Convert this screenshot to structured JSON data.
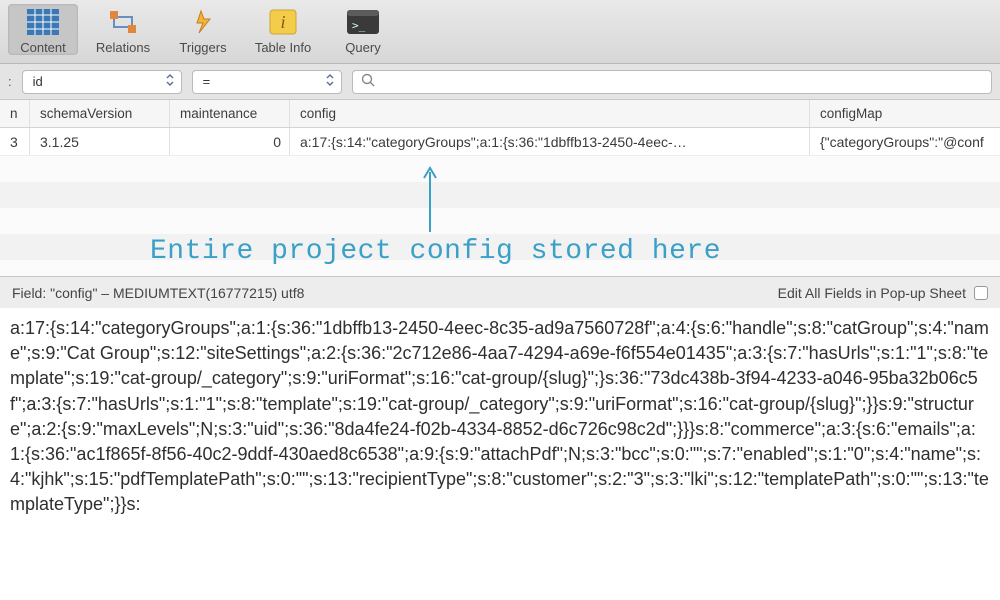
{
  "toolbar": {
    "items": [
      {
        "label": "Content",
        "icon": "table-icon",
        "selected": true
      },
      {
        "label": "Relations",
        "icon": "relations-icon",
        "selected": false
      },
      {
        "label": "Triggers",
        "icon": "triggers-icon",
        "selected": false
      },
      {
        "label": "Table Info",
        "icon": "info-icon",
        "selected": false
      },
      {
        "label": "Query",
        "icon": "terminal-icon",
        "selected": false
      }
    ]
  },
  "filter": {
    "prefix": ":",
    "field": "id",
    "operator": "=",
    "search_placeholder": ""
  },
  "columns": {
    "n": "n",
    "schemaVersion": "schemaVersion",
    "maintenance": "maintenance",
    "config": "config",
    "configMap": "configMap"
  },
  "row": {
    "n": "3",
    "schemaVersion": "3.1.25",
    "maintenance": "0",
    "config": "a:17:{s:14:\"categoryGroups\";a:1:{s:36:\"1dbffb13-2450-4eec-…",
    "configMap": "{\"categoryGroups\":\"@conf"
  },
  "annotation": {
    "text": "Entire project config stored here"
  },
  "detail": {
    "field_label": "Field: \"config\" – MEDIUMTEXT(16777215) utf8",
    "edit_label": "Edit All Fields in Pop-up Sheet"
  },
  "config_full": "a:17:{s:14:\"categoryGroups\";a:1:{s:36:\"1dbffb13-2450-4eec-8c35-ad9a7560728f\";a:4:{s:6:\"handle\";s:8:\"catGroup\";s:4:\"name\";s:9:\"Cat Group\";s:12:\"siteSettings\";a:2:{s:36:\"2c712e86-4aa7-4294-a69e-f6f554e01435\";a:3:{s:7:\"hasUrls\";s:1:\"1\";s:8:\"template\";s:19:\"cat-group/_category\";s:9:\"uriFormat\";s:16:\"cat-group/{slug}\";}s:36:\"73dc438b-3f94-4233-a046-95ba32b06c5f\";a:3:{s:7:\"hasUrls\";s:1:\"1\";s:8:\"template\";s:19:\"cat-group/_category\";s:9:\"uriFormat\";s:16:\"cat-group/{slug}\";}}s:9:\"structure\";a:2:{s:9:\"maxLevels\";N;s:3:\"uid\";s:36:\"8da4fe24-f02b-4334-8852-d6c726c98c2d\";}}}s:8:\"commerce\";a:3:{s:6:\"emails\";a:1:{s:36:\"ac1f865f-8f56-40c2-9ddf-430aed8c6538\";a:9:{s:9:\"attachPdf\";N;s:3:\"bcc\";s:0:\"\";s:7:\"enabled\";s:1:\"0\";s:4:\"name\";s:4:\"kjhk\";s:15:\"pdfTemplatePath\";s:0:\"\";s:13:\"recipientType\";s:8:\"customer\";s:2:\"3\";s:3:\"lki\";s:12:\"templatePath\";s:0:\"\";s:13:\"templateType\";}}s:"
}
